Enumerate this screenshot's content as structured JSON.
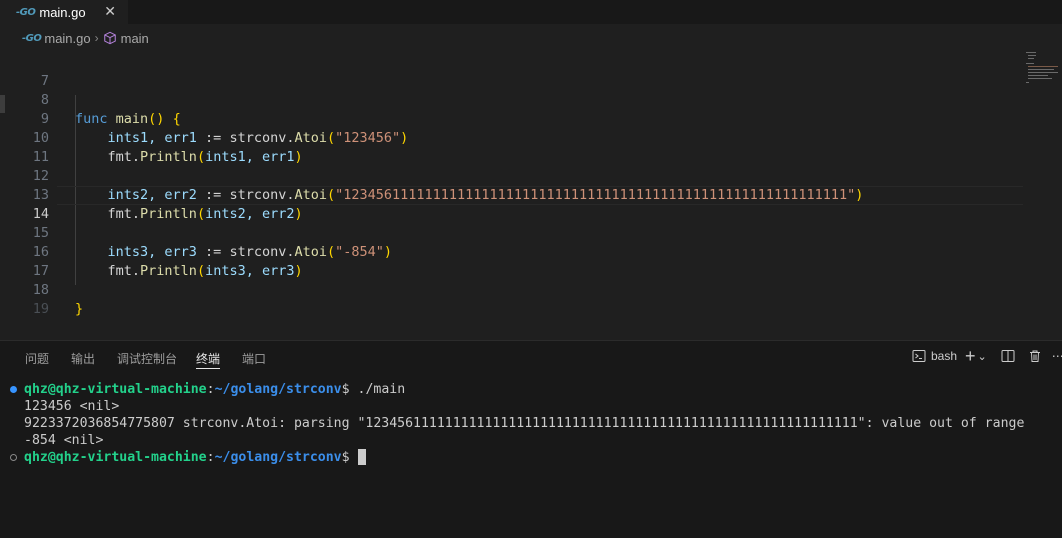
{
  "tab": {
    "icon": "-GO",
    "label": "main.go",
    "close": "✕"
  },
  "breadcrumb": {
    "icon": "-GO",
    "file": "main.go",
    "separator": "›",
    "symbol": "main"
  },
  "editor": {
    "lines": [
      {
        "num": "7"
      },
      {
        "num": "8"
      },
      {
        "num": "9"
      },
      {
        "num": "10"
      },
      {
        "num": "11"
      },
      {
        "num": "12"
      },
      {
        "num": "13"
      },
      {
        "num": "14"
      },
      {
        "num": "15"
      },
      {
        "num": "16"
      },
      {
        "num": "17"
      },
      {
        "num": "18"
      },
      {
        "num": "19"
      }
    ],
    "code": {
      "l8": {
        "kw": "func",
        "fn": "main",
        "paren": "()",
        "brace": "{"
      },
      "l9": {
        "v": "ints1, err1",
        "op": " := ",
        "pkg": "strconv.",
        "fn": "Atoi",
        "str": "\"123456\""
      },
      "l10": {
        "pkg": "fmt.",
        "fn": "Println",
        "args": "ints1, err1"
      },
      "l12": {
        "v": "ints2, err2",
        "op": " := ",
        "pkg": "strconv.",
        "fn": "Atoi",
        "str": "\"12345611111111111111111111111111111111111111111111111111111111\""
      },
      "l13": {
        "pkg": "fmt.",
        "fn": "Println",
        "args": "ints2, err2"
      },
      "l15": {
        "v": "ints3, err3",
        "op": " := ",
        "pkg": "strconv.",
        "fn": "Atoi",
        "str": "\"-854\""
      },
      "l16": {
        "pkg": "fmt.",
        "fn": "Println",
        "args": "ints3, err3"
      },
      "l18": {
        "brace": "}"
      }
    }
  },
  "panel": {
    "tabs": [
      "问题",
      "输出",
      "调试控制台",
      "终端",
      "端口"
    ],
    "active_tab": "终端",
    "shell_label": "bash",
    "add_icon": "+",
    "dropdown_icon": "⌄",
    "more_icon": "⋯"
  },
  "terminal": {
    "prompt_user": "qhz@qhz-virtual-machine",
    "prompt_path": "~/golang/strconv",
    "prompt_sym": "$",
    "command": " ./main",
    "out1": "123456 <nil>",
    "out2": "9223372036854775807 strconv.Atoi: parsing \"12345611111111111111111111111111111111111111111111111111111111\": value out of range",
    "out3": "-854 <nil>",
    "prompt2_user": "qhz@qhz-virtual-machine",
    "prompt2_path": "~/golang/strconv",
    "prompt2_sym": "$"
  }
}
